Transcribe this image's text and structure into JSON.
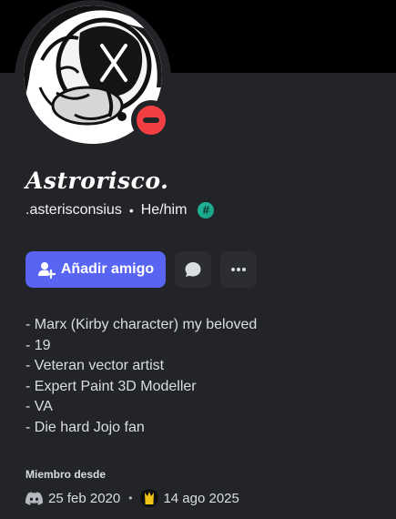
{
  "profile": {
    "display_name": "Astrorisco.",
    "username": ".asterisconsius",
    "separator": "•",
    "pronouns": "He/him",
    "status": "do-not-disturb",
    "status_color": "#f23f43"
  },
  "actions": {
    "add_friend_label": "Añadir amigo",
    "message_icon": "chat-bubble-icon",
    "more_icon": "ellipsis-icon"
  },
  "bio": {
    "lines": [
      "- Marx (Kirby character) my beloved",
      "- 19",
      "- Veteran vector artist",
      "- Expert Paint 3D Modeller",
      "- VA",
      "- Die hard Jojo fan"
    ]
  },
  "member_since": {
    "label": "Miembro desde",
    "discord_date": "25 feb 2020",
    "separator": "•",
    "server_date": "14 ago 2025"
  },
  "colors": {
    "background": "#232428",
    "banner": "#000000",
    "accent": "#5865f2",
    "badge": "#1fb89a"
  }
}
